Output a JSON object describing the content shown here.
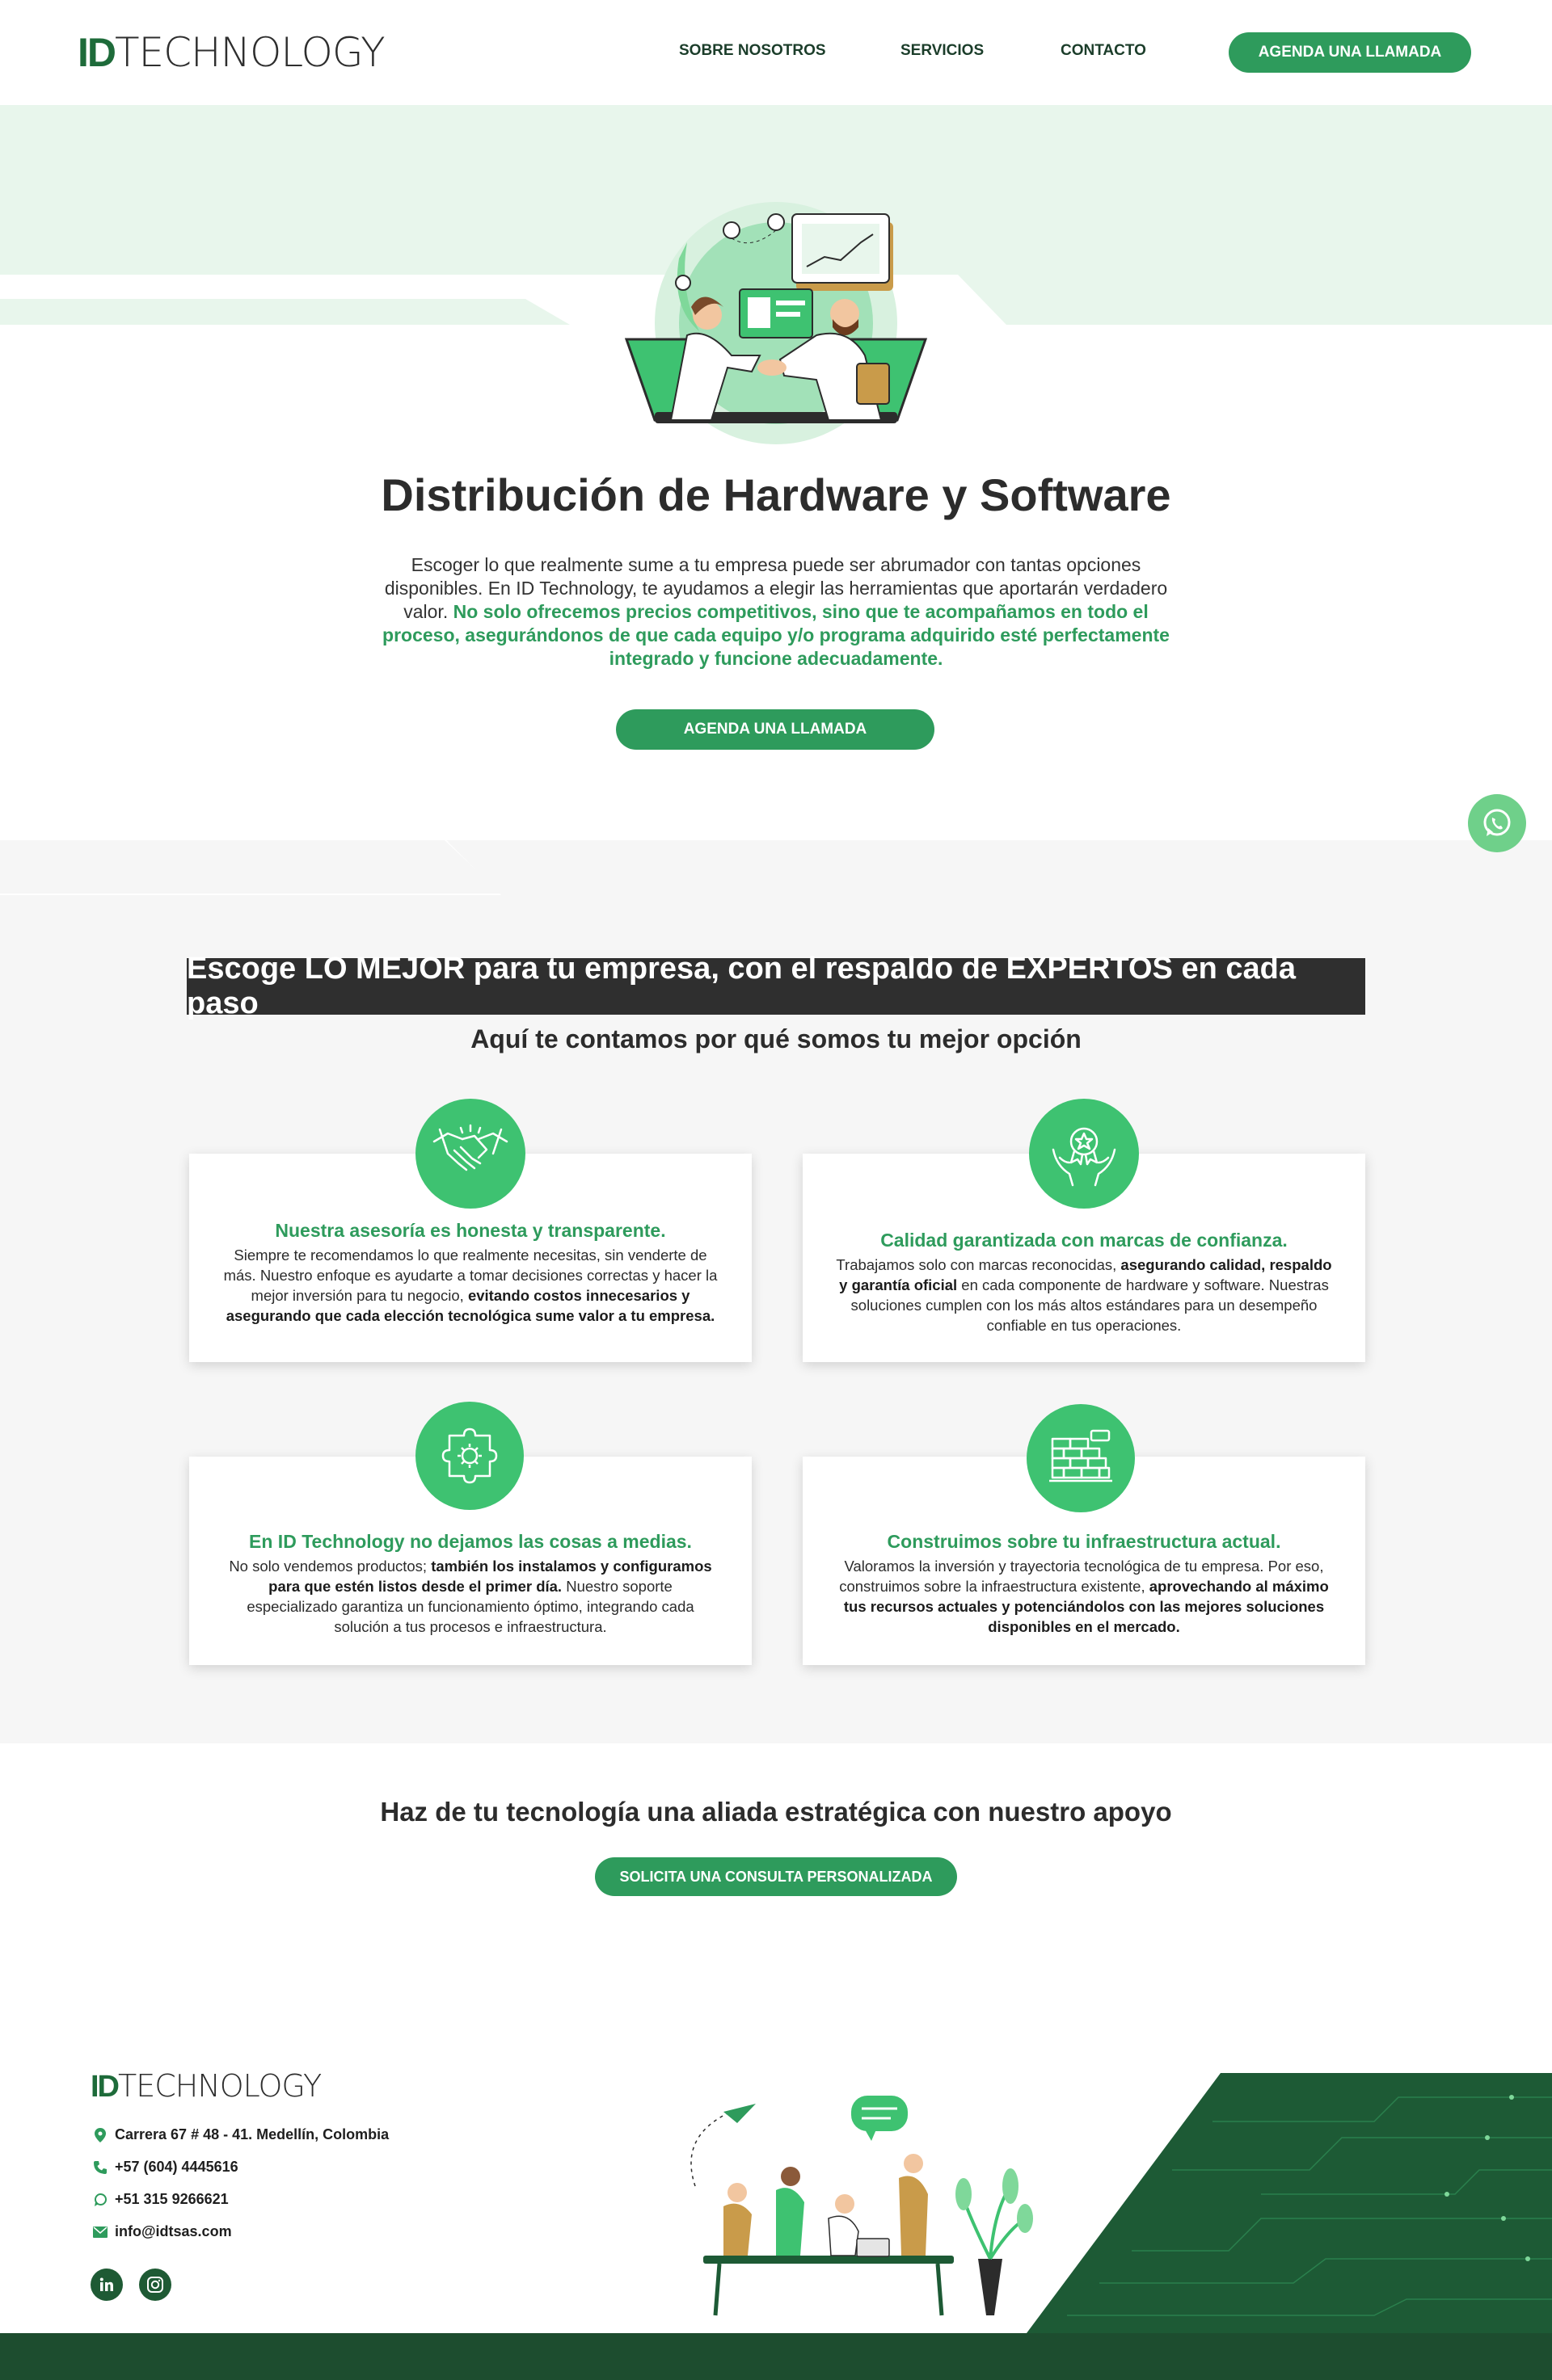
{
  "header": {
    "logo_id": "ID",
    "logo_text": "TECHNOLOGY",
    "nav": [
      {
        "label": "SOBRE NOSOTROS"
      },
      {
        "label": "SERVICIOS"
      },
      {
        "label": "CONTACTO"
      }
    ],
    "cta_label": "AGENDA UNA LLAMADA"
  },
  "hero": {
    "title": "Distribución de Hardware y Software",
    "text_plain": "Escoger lo que realmente sume a tu empresa puede ser abrumador con tantas opciones disponibles. En ID Technology, te ayudamos a elegir las herramientas que aportarán verdadero valor.",
    "text_highlight": "No solo ofrecemos precios competitivos, sino que te acompañamos en todo el proceso, asegurándonos de que cada equipo y/o programa adquirido esté perfectamente integrado y funcione adecuadamente.",
    "cta_label": "AGENDA UNA LLAMADA"
  },
  "features": {
    "banner": "Escoge LO MEJOR para tu empresa, con el respaldo de EXPERTOS en cada paso",
    "subtitle": "Aquí te contamos por qué somos tu mejor opción",
    "cards": [
      {
        "icon": "handshake-icon",
        "title": "Nuestra asesoría es honesta y transparente.",
        "body_1": "Siempre te recomendamos lo que realmente necesitas, sin venderte de más. Nuestro enfoque es ayudarte a tomar decisiones correctas y hacer la mejor inversión para tu negocio,",
        "body_bold": "evitando costos innecesarios y asegurando que cada elección tecnológica sume valor a tu empresa."
      },
      {
        "icon": "quality-badge-icon",
        "title": "Calidad garantizada con marcas de confianza.",
        "body_1": "Trabajamos solo con marcas reconocidas,",
        "body_bold": "asegurando calidad, respaldo y garantía oficial",
        "body_2": "en cada componente de hardware y software. Nuestras soluciones cumplen con los más altos estándares para un desempeño confiable en tus operaciones."
      },
      {
        "icon": "gear-puzzle-icon",
        "title": "En ID Technology no dejamos las cosas a medias.",
        "body_1": "No solo vendemos productos;",
        "body_bold": "también los instalamos y configuramos para que estén listos desde el primer día.",
        "body_2": "Nuestro soporte especializado garantiza un funcionamiento óptimo, integrando cada solución a tus procesos e infraestructura."
      },
      {
        "icon": "brick-wall-icon",
        "title": "Construimos sobre tu infraestructura actual.",
        "body_1": "Valoramos la inversión y trayectoria tecnológica de tu empresa. Por eso, construimos sobre la infraestructura existente,",
        "body_bold": "aprovechando al máximo tus recursos actuales y potenciándolos con las mejores soluciones disponibles en el mercado."
      }
    ]
  },
  "cta": {
    "title": "Haz de tu tecnología una aliada estratégica con nuestro apoyo",
    "button": "SOLICITA UNA CONSULTA PERSONALIZADA"
  },
  "footer": {
    "logo_id": "ID",
    "logo_text": "TECHNOLOGY",
    "address": "Carrera 67 # 48 - 41. Medellín, Colombia",
    "phone": "+57 (604) 4445616",
    "whatsapp": "+51 315 9266621",
    "email": "info@idtsas.com"
  },
  "colors": {
    "primary": "#2e9b5c",
    "accent": "#3ec271",
    "dark_green": "#1d4d2f",
    "banner": "#2f2f2f",
    "hero_band": "#e8f6ec"
  }
}
